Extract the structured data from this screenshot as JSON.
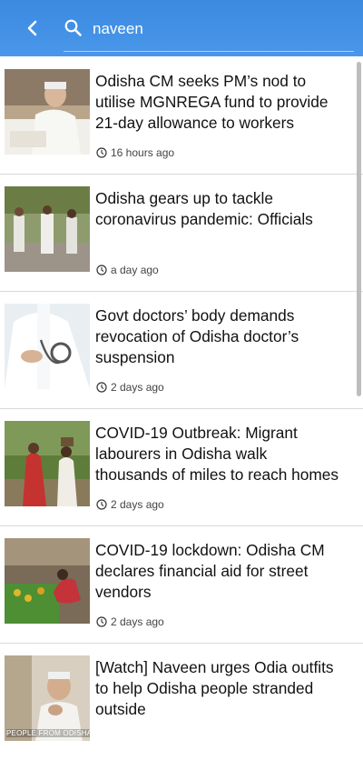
{
  "header": {
    "back_icon": "back-arrow-icon",
    "search_icon": "search-icon",
    "search_value": "naveen",
    "accent_color": "#3f8fe6"
  },
  "articles": [
    {
      "title": "Odisha CM seeks PM’s nod to utilise MGNREGA fund to provide 21-day allowance to workers",
      "time": "16 hours ago"
    },
    {
      "title": "Odisha gears up to tackle coronavirus pandemic: Officials",
      "time": "a day ago"
    },
    {
      "title": "Govt doctors’ body demands revocation of Odisha doctor’s suspension",
      "time": "2 days ago"
    },
    {
      "title": "COVID-19 Outbreak: Migrant labourers in Odisha walk thousands of miles to reach homes",
      "time": "2 days ago"
    },
    {
      "title": "COVID-19 lockdown: Odisha CM declares financial aid for street vendors",
      "time": "2 days ago"
    },
    {
      "title": "[Watch] Naveen urges Odia outfits to help Odisha people stranded outside",
      "time": "",
      "thumb_caption": "PEOPLE FROM ODISHA"
    }
  ]
}
